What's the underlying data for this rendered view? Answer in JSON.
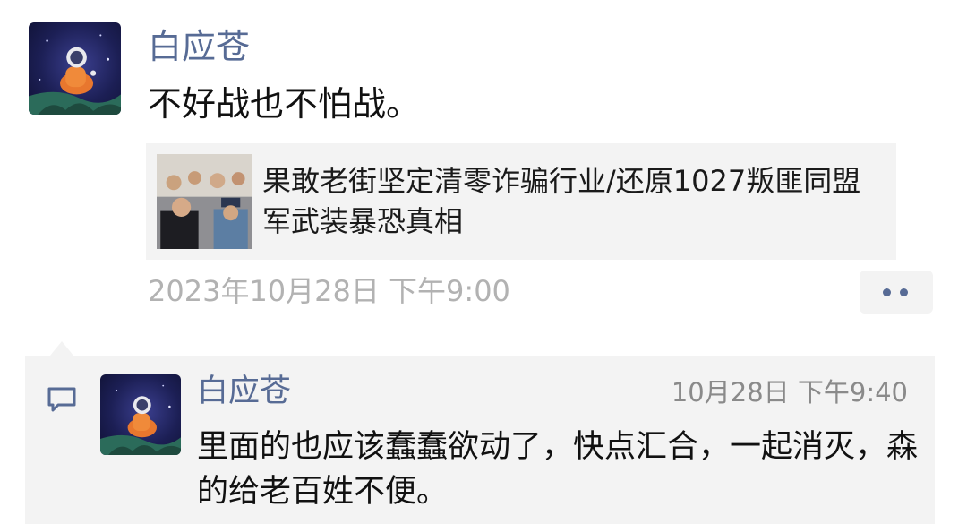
{
  "post": {
    "author": "白应苍",
    "text": "不好战也不怕战。",
    "link": {
      "title": "果敢老街坚定清零诈骗行业/还原1027叛匪同盟军武装暴恐真相"
    },
    "timestamp": "2023年10月28日 下午9:00"
  },
  "comment": {
    "author": "白应苍",
    "time": "10月28日 下午9:40",
    "text": "里面的也应该蠢蠢欲动了，快点汇合，一起消灭，森的给老百姓不便。"
  },
  "icons": {
    "more": "more-dots-icon",
    "comment": "comment-bubble-icon"
  },
  "colors": {
    "name_link": "#576b95",
    "timestamp": "#b2b2b2",
    "comment_bg": "#f3f3f3"
  }
}
